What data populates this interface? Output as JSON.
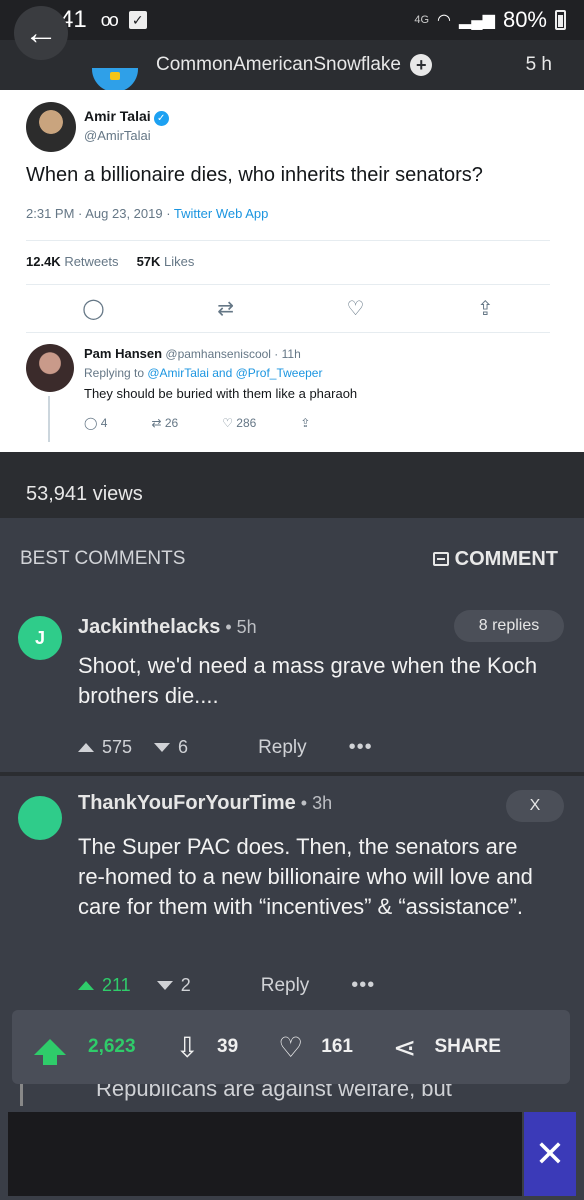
{
  "status_bar": {
    "time": "9:41",
    "voicemail": "oo",
    "network": "4G",
    "battery": "80%"
  },
  "header": {
    "back_icon": "arrow-left",
    "poster": "CommonAmericanSnowflake",
    "follow_icon": "+",
    "age": "5 h"
  },
  "tweet": {
    "name": "Amir Talai",
    "handle": "@AmirTalai",
    "text": "When a billionaire dies, who inherits their senators?",
    "meta": "2:31 PM · Aug 23, 2019 · ",
    "app": "Twitter Web App",
    "retweets_count": "12.4K",
    "retweets_label": " Retweets",
    "likes_count": "57K",
    "likes_label": " Likes",
    "reply": {
      "name": "Pam Hansen",
      "handle_time": " @pamhanseniscool · 11h",
      "replying_prefix": "Replying to ",
      "replying_targets": "@AmirTalai and @Prof_Tweeper",
      "text": "They should be buried with them like a pharaoh",
      "replies": "4",
      "retweets": "26",
      "likes": "286"
    }
  },
  "views": "53,941 views",
  "comments_header": {
    "title": "BEST COMMENTS",
    "comment_button": "COMMENT"
  },
  "comments": [
    {
      "avatar_letter": "J",
      "user": "Jackinthelacks",
      "age": " • 5h",
      "badge": "8 replies",
      "text": "Shoot, we'd need a mass grave when the Koch brothers die....",
      "upvotes": "575",
      "downvotes": "6",
      "reply": "Reply",
      "more": "•••"
    },
    {
      "avatar_letter": "",
      "user": "ThankYouForYourTime",
      "age": " • 3h",
      "badge": "X",
      "text": "The Super PAC does. Then, the senators are re-homed to a new billionaire who will love and care for them with “incentives” & “assistance”.",
      "upvotes": "211",
      "downvotes": "2",
      "reply": "Reply",
      "more": "•••"
    }
  ],
  "action_bar": {
    "upvotes": "2,623",
    "downvotes": "39",
    "favorites": "161",
    "share": "SHARE"
  },
  "peek_text": "Republicans are against welfare, but",
  "ad": {
    "close": "✕"
  },
  "colors": {
    "green": "#2fcc6a",
    "background": "#3a3e47",
    "bar": "#2b2d31",
    "ad_close": "#3b3ab8"
  }
}
